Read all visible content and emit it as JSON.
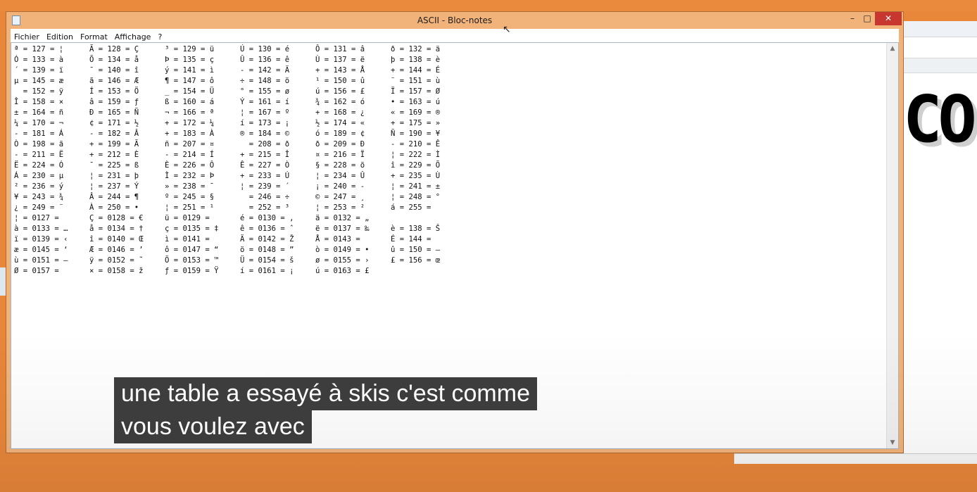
{
  "window": {
    "title": "ASCII - Bloc-notes",
    "controls": {
      "minimize": "–",
      "maximize": "□",
      "close": "✕"
    }
  },
  "menu": [
    "Fichier",
    "Edition",
    "Format",
    "Affichage",
    "?"
  ],
  "background_window": {
    "text": "COI"
  },
  "editor_rows": [
    [
      "ª = 127 = ¦",
      "Ã = 128 = Ç",
      "³ = 129 = ü",
      "Ú = 130 = é",
      "Ô = 131 = â",
      "ð = 132 = ä"
    ],
    [
      "Ó = 133 = à",
      "Õ = 134 = å",
      "Þ = 135 = ç",
      "Û = 136 = ê",
      "Ù = 137 = ë",
      "þ = 138 = è"
    ],
    [
      "´ = 139 = ï",
      "¯ = 140 = î",
      "ý = 141 = ì",
      "- = 142 = Ä",
      "+ = 143 = Å",
      "+ = 144 = É"
    ],
    [
      "µ = 145 = æ",
      "ã = 146 = Æ",
      "¶ = 147 = ô",
      "÷ = 148 = ö",
      "¹ = 150 = û",
      "¨ = 151 = ù"
    ],
    [
      "  = 152 = ÿ",
      "Í = 153 = Ö",
      "_ = 154 = Ü",
      "° = 155 = ø",
      "ú = 156 = £",
      "Ï = 157 = Ø"
    ],
    [
      "Î = 158 = ×",
      "â = 159 = ƒ",
      "ß = 160 = á",
      "Ý = 161 = í",
      "¾ = 162 = ó",
      "• = 163 = ú"
    ],
    [
      "± = 164 = ñ",
      "Ð = 165 = Ñ",
      "¬ = 166 = ª",
      "¦ = 167 = º",
      "+ = 168 = ¿",
      "« = 169 = ®"
    ],
    [
      "¼ = 170 = ¬",
      "¢ = 171 = ½",
      "+ = 172 = ¼",
      "í = 173 = ¡",
      "½ = 174 = «",
      "+ = 175 = »"
    ],
    [
      "- = 181 = Á",
      "- = 182 = Â",
      "+ = 183 = À",
      "® = 184 = ©",
      "ó = 189 = ¢",
      "Ñ = 190 = ¥"
    ],
    [
      "Ò = 198 = ã",
      "+ = 199 = Ã",
      "ñ = 207 = ¤",
      "  = 208 = ð",
      "ð = 209 = Ð",
      "- = 210 = Ê"
    ],
    [
      "- = 211 = Ë",
      "+ = 212 = È",
      "- = 214 = Í",
      "+ = 215 = Î",
      "¤ = 216 = Ï",
      "¦ = 222 = Ì"
    ],
    [
      "Ë = 224 = Ó",
      "¯ = 225 = ß",
      "È = 226 = Ô",
      "Ê = 227 = Ò",
      "§ = 228 = õ",
      "î = 229 = Õ"
    ],
    [
      "Á = 230 = µ",
      "¦ = 231 = þ",
      "Ì = 232 = Þ",
      "+ = 233 = Ú",
      "¦ = 234 = Û",
      "+ = 235 = Ù"
    ],
    [
      "² = 236 = ý",
      "¦ = 237 = Ý",
      "» = 238 = ¯",
      "¦ = 239 = ´",
      "¡ = 240 = -",
      "¦ = 241 = ±"
    ],
    [
      "¥ = 243 = ¾",
      "Â = 244 = ¶",
      "º = 245 = §",
      "  = 246 = ÷",
      "© = 247 = ¸",
      "¦ = 248 = °"
    ],
    [
      "¿ = 249 = ¨",
      "À = 250 = •",
      "¦ = 251 = ¹",
      "  = 252 = ³",
      "¦ = 253 = ²",
      "á = 255 ="
    ],
    [
      "¦ = 0127 =",
      "Ç = 0128 = €",
      "ü = 0129 =",
      "é = 0130 = ‚",
      "ä = 0132 = „",
      ""
    ],
    [
      "à = 0133 = …",
      "å = 0134 = †",
      "ç = 0135 = ‡",
      "ê = 0136 = ˆ",
      "ë = 0137 = ‰",
      "è = 138 = Š"
    ],
    [
      "ï = 0139 = ‹",
      "î = 0140 = Œ",
      "ì = 0141 =",
      "Ä = 0142 = Ž",
      "Å = 0143 =",
      "É = 144 ="
    ],
    [
      "æ = 0145 = ‘",
      "Æ = 0146 = ’",
      "ô = 0147 = “",
      "ö = 0148 = ”",
      "ò = 0149 = •",
      "û = 150 = –"
    ],
    [
      "ù = 0151 = —",
      "ÿ = 0152 = ˜",
      "Ö = 0153 = ™",
      "Ü = 0154 = š",
      "ø = 0155 = ›",
      "£ = 156 = œ"
    ],
    [
      "Ø = 0157 =",
      "× = 0158 = ž",
      "ƒ = 0159 = Ÿ",
      "í = 0161 = ¡",
      "ú = 0163 = £",
      ""
    ]
  ],
  "subtitles": [
    "une table a essayé à skis c'est comme",
    "vous voulez avec"
  ]
}
